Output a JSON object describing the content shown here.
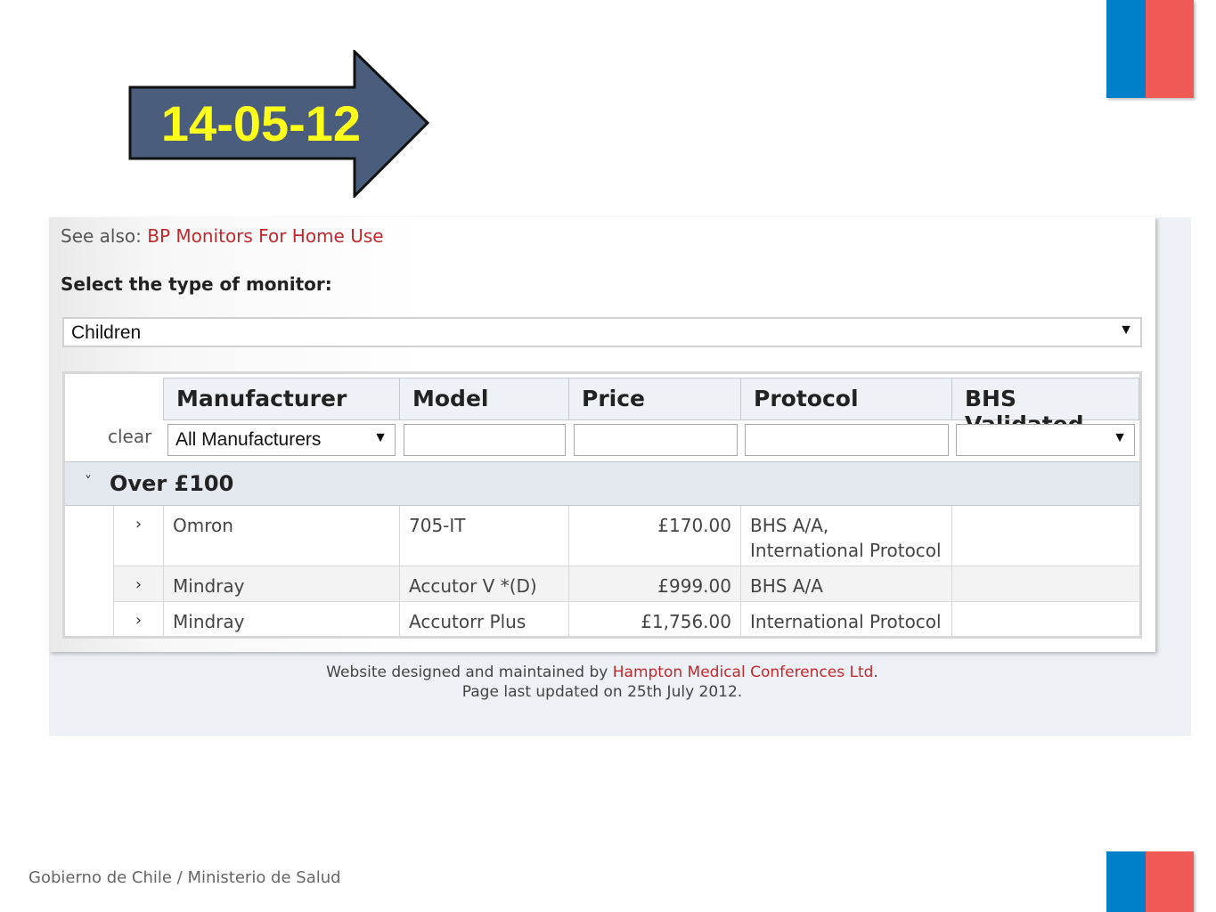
{
  "colors": {
    "flag_blue": "#0080c8",
    "flag_red": "#f05a55",
    "arrow_fill": "#4a5d7d",
    "arrow_text": "#ffff1a",
    "link": "#c0292c"
  },
  "arrow": {
    "date_label": "14-05-12"
  },
  "page": {
    "see_also_prefix": "See also: ",
    "see_also_link": "BP Monitors For Home Use",
    "select_prompt": "Select the type of monitor:",
    "monitor_type_selected": "Children"
  },
  "table": {
    "headers": [
      "Manufacturer",
      "Model",
      "Price",
      "Protocol",
      "BHS Validated"
    ],
    "clear_label": "clear",
    "filters": {
      "manufacturer_selected": "All Manufacturers",
      "model": "",
      "price": "",
      "protocol": "",
      "bhs_validated": ""
    },
    "group": {
      "label": "Over £100"
    },
    "rows": [
      {
        "manufacturer": "Omron",
        "model": "705-IT",
        "price": "£170.00",
        "protocol": "BHS A/A, International Protocol",
        "bhs": ""
      },
      {
        "manufacturer": "Mindray",
        "model": "Accutor V *(D)",
        "price": "£999.00",
        "protocol": "BHS A/A",
        "bhs": ""
      },
      {
        "manufacturer": "Mindray",
        "model": "Accutorr Plus",
        "price": "£1,756.00",
        "protocol": "International Protocol",
        "bhs": ""
      }
    ]
  },
  "footer": {
    "line1_prefix": "Website designed and maintained by ",
    "line1_link": "Hampton Medical Conferences Ltd",
    "line1_suffix": ".",
    "line2": "Page last updated on 25th July 2012."
  },
  "slide_footer": "Gobierno de Chile / Ministerio de Salud"
}
